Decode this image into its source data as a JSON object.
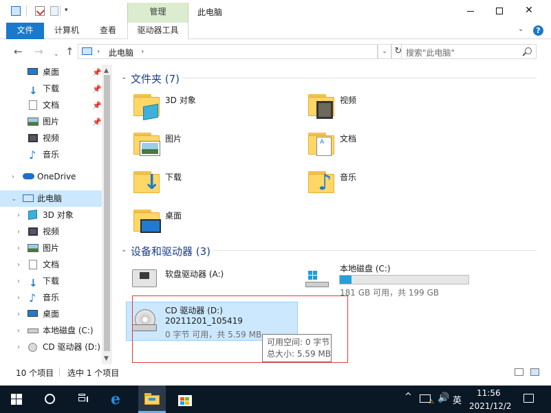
{
  "titlebar": {
    "ribbon_context_label": "管理",
    "window_title": "此电脑",
    "quick_access": [
      "computer-icon",
      "properties-icon",
      "new-folder-icon",
      "customize-dropdown-icon"
    ],
    "controls": [
      "minimize",
      "maximize",
      "close"
    ]
  },
  "ribbon": {
    "tabs": [
      "文件",
      "计算机",
      "查看",
      "驱动器工具"
    ],
    "active_tab": "文件",
    "help_label": "?",
    "colors": {
      "file_tab": "#1979ca",
      "context_tab": "#dbeccf"
    }
  },
  "nav": {
    "address_path": [
      "此电脑"
    ],
    "search_placeholder": "搜索\"此电脑\""
  },
  "sidebar": {
    "pinned": [
      {
        "label": "桌面",
        "icon": "desktop-icon",
        "pinned": true
      },
      {
        "label": "下载",
        "icon": "download-icon",
        "pinned": true
      },
      {
        "label": "文档",
        "icon": "documents-icon",
        "pinned": true
      },
      {
        "label": "图片",
        "icon": "pictures-icon",
        "pinned": true
      },
      {
        "label": "视频",
        "icon": "videos-icon",
        "pinned": false
      },
      {
        "label": "音乐",
        "icon": "music-icon",
        "pinned": false
      }
    ],
    "onedrive": "OneDrive",
    "this_pc": "此电脑",
    "pc_children": [
      {
        "label": "3D 对象",
        "icon": "3d-objects-icon"
      },
      {
        "label": "视频",
        "icon": "videos-icon"
      },
      {
        "label": "图片",
        "icon": "pictures-icon"
      },
      {
        "label": "文档",
        "icon": "documents-icon"
      },
      {
        "label": "下载",
        "icon": "download-icon"
      },
      {
        "label": "音乐",
        "icon": "music-icon"
      },
      {
        "label": "桌面",
        "icon": "desktop-icon"
      },
      {
        "label": "本地磁盘 (C:)",
        "icon": "local-disk-icon"
      },
      {
        "label": "CD 驱动器 (D:)",
        "icon": "cd-drive-icon"
      }
    ]
  },
  "main": {
    "folders_header": "文件夹 (7)",
    "folders": [
      {
        "label": "3D 对象",
        "icon": "3d-objects-icon"
      },
      {
        "label": "视频",
        "icon": "videos-icon"
      },
      {
        "label": "图片",
        "icon": "pictures-icon"
      },
      {
        "label": "文档",
        "icon": "documents-icon"
      },
      {
        "label": "下载",
        "icon": "download-icon"
      },
      {
        "label": "音乐",
        "icon": "music-icon"
      },
      {
        "label": "桌面",
        "icon": "desktop-icon"
      }
    ],
    "drives_header": "设备和驱动器 (3)",
    "floppy": {
      "label": "软盘驱动器 (A:)"
    },
    "local_disk": {
      "label": "本地磁盘 (C:)",
      "space": "181 GB 可用，共 199 GB",
      "used_fraction": 0.09
    },
    "cd_drive": {
      "label": "CD 驱动器 (D:)",
      "volume": "20211201_105419",
      "space": "0 字节 可用，共 5.59 MB"
    },
    "tooltip": {
      "line1": "可用空间: 0 字节",
      "line2": "总大小: 5.59 MB"
    }
  },
  "status": {
    "item_count": "10 个项目",
    "selection": "选中 1 个项目"
  },
  "taskbar": {
    "apps": [
      "start-icon",
      "search-circle-icon",
      "task-view-icon",
      "edge-icon",
      "file-explorer-icon",
      "store-icon"
    ],
    "active_app": "file-explorer-icon",
    "ime": "英",
    "time": "11:56",
    "date": "2021/12/2"
  }
}
